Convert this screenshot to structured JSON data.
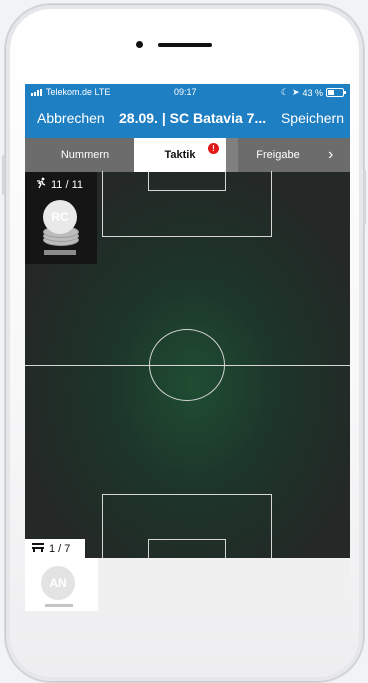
{
  "status_bar": {
    "carrier": "Telekom.de LTE",
    "time": "09:17",
    "battery": "43 %"
  },
  "nav": {
    "cancel_label": "Abbrechen",
    "title": "28.09. | SC Batavia 7...",
    "save_label": "Speichern"
  },
  "tabs": [
    {
      "label": "Nummern",
      "active": false
    },
    {
      "label": "Taktik",
      "active": true,
      "badge": "!"
    },
    {
      "label": "Freigabe",
      "active": false
    }
  ],
  "more_tabs_icon": "chevron-right-icon",
  "lineup": {
    "count": "11 / 11",
    "icon": "running-player-icon",
    "player_initials": "RC"
  },
  "bench": {
    "count": "1 / 7",
    "icon": "bench-icon",
    "player_initials": "AN"
  },
  "colors": {
    "nav_blue": "#1f7fc3",
    "tab_gray": "#6c6c6c",
    "badge_red": "#e01818",
    "pitch_green": "#1f4d32"
  }
}
